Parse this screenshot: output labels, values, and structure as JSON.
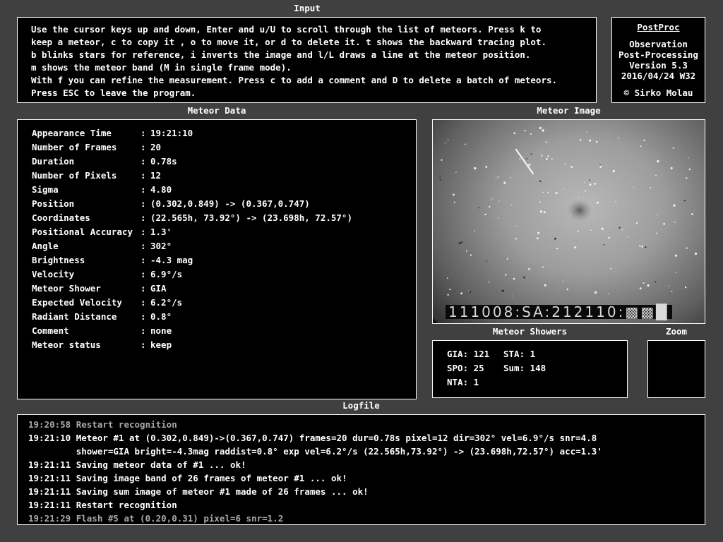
{
  "input": {
    "title": "Input",
    "lines": [
      "Use the cursor keys up and down, Enter and u/U to scroll through the list of meteors. Press k to",
      "keep a meteor, c to copy it , o to move it, or d to delete it. t shows the backward tracing plot.",
      "b blinks stars for reference, i inverts the image and l/L draws a line at the meteor position.",
      "m shows the meteor band (M in single frame mode).",
      "With f you can refine the measurement. Press c to add a comment and D to delete a batch of meteors.",
      "Press ESC to leave the program."
    ]
  },
  "about": {
    "name": "PostProc",
    "line1": "Observation",
    "line2": "Post-Processing",
    "version": "Version 5.3",
    "build": "2016/04/24 W32",
    "copyright_symbol": "©",
    "author": "Sirko Molau"
  },
  "meteor_data": {
    "title": "Meteor Data",
    "separator": ":",
    "rows": [
      {
        "label": "Appearance Time",
        "value": "19:21:10"
      },
      {
        "label": "Number of Frames",
        "value": "20"
      },
      {
        "label": "Duration",
        "value": "0.78s"
      },
      {
        "label": "Number of Pixels",
        "value": "12"
      },
      {
        "label": "Sigma",
        "value": "4.80"
      },
      {
        "label": "Position",
        "value": "(0.302,0.849) -> (0.367,0.747)"
      },
      {
        "label": "Coordinates",
        "value": "(22.565h, 73.92°) -> (23.698h, 72.57°)"
      },
      {
        "label": "Positional Accuracy",
        "value": "1.3'"
      },
      {
        "label": "Angle",
        "value": "302°"
      },
      {
        "label": "Brightness",
        "value": "-4.3 mag"
      },
      {
        "label": "Velocity",
        "value": "6.9°/s"
      },
      {
        "label": "Meteor Shower",
        "value": "GIA"
      },
      {
        "label": "Expected Velocity",
        "value": "6.2°/s"
      },
      {
        "label": "Radiant Distance",
        "value": "0.8°"
      },
      {
        "label": "Comment",
        "value": "none"
      },
      {
        "label": "Meteor status",
        "value": "keep"
      }
    ]
  },
  "meteor_image": {
    "title": "Meteor Image",
    "timestamp_overlay": "111008:SA:212110:",
    "overlay_suffix_glyphs": "▩▩█"
  },
  "meteor_showers": {
    "title": "Meteor Showers",
    "rows": [
      [
        "GIA: 121",
        "STA: 1"
      ],
      [
        "SPO: 25",
        "Sum: 148"
      ],
      [
        "NTA: 1",
        ""
      ]
    ]
  },
  "zoom": {
    "title": "Zoom"
  },
  "logfile": {
    "title": "Logfile",
    "entries": [
      {
        "text": "19:20:58 Restart recognition",
        "dim": true
      },
      {
        "text": "19:21:10 Meteor #1 at (0.302,0.849)->(0.367,0.747) frames=20 dur=0.78s pixel=12 dir=302° vel=6.9°/s snr=4.8",
        "dim": false
      },
      {
        "text": "         shower=GIA bright=-4.3mag raddist=0.8° exp vel=6.2°/s (22.565h,73.92°) -> (23.698h,72.57°) acc=1.3'",
        "dim": false
      },
      {
        "text": "19:21:11 Saving meteor data of #1 ... ok!",
        "dim": false
      },
      {
        "text": "19:21:11 Saving image band of 26 frames of meteor #1 ... ok!",
        "dim": false
      },
      {
        "text": "19:21:11 Saving sum image of meteor #1 made of 26 frames ... ok!",
        "dim": false
      },
      {
        "text": "19:21:11 Restart recognition",
        "dim": false
      },
      {
        "text": "19:21:29 Flash #5 at (0.20,0.31) pixel=6 snr=1.2",
        "dim": true
      }
    ]
  }
}
